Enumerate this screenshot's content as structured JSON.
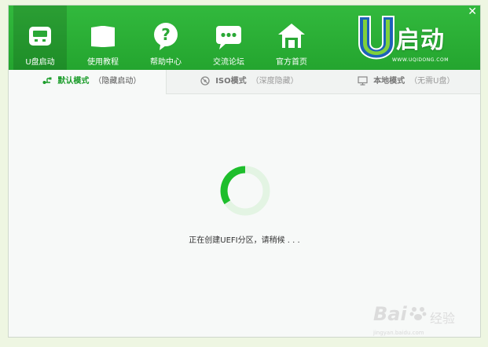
{
  "nav": {
    "items": [
      {
        "label": "U盘启动",
        "icon": "usb-drive-icon"
      },
      {
        "label": "使用教程",
        "icon": "book-icon"
      },
      {
        "label": "帮助中心",
        "icon": "help-icon"
      },
      {
        "label": "交流论坛",
        "icon": "chat-icon"
      },
      {
        "label": "官方首页",
        "icon": "home-icon"
      }
    ],
    "active_index": 0
  },
  "close_label": "✕",
  "logo": {
    "text": "启动",
    "sub": "WWW.UQIDONG.COM"
  },
  "tabs": [
    {
      "title": "默认模式",
      "sub": "（隐藏启动）",
      "icon": "usb-symbol-icon"
    },
    {
      "title": "ISO模式",
      "sub": "（深度隐藏）",
      "icon": "disc-icon"
    },
    {
      "title": "本地模式",
      "sub": "（无需U盘）",
      "icon": "monitor-icon"
    }
  ],
  "status_text": "正在创建UEFI分区，请稍候 . . .",
  "watermark": {
    "brand": "Bai",
    "brand_suffix": "经验",
    "url": "jingyan.baidu.com"
  },
  "colors": {
    "header": "#2db23a",
    "accent": "#1c9d2b",
    "spinner_track": "#e3f4e3"
  }
}
